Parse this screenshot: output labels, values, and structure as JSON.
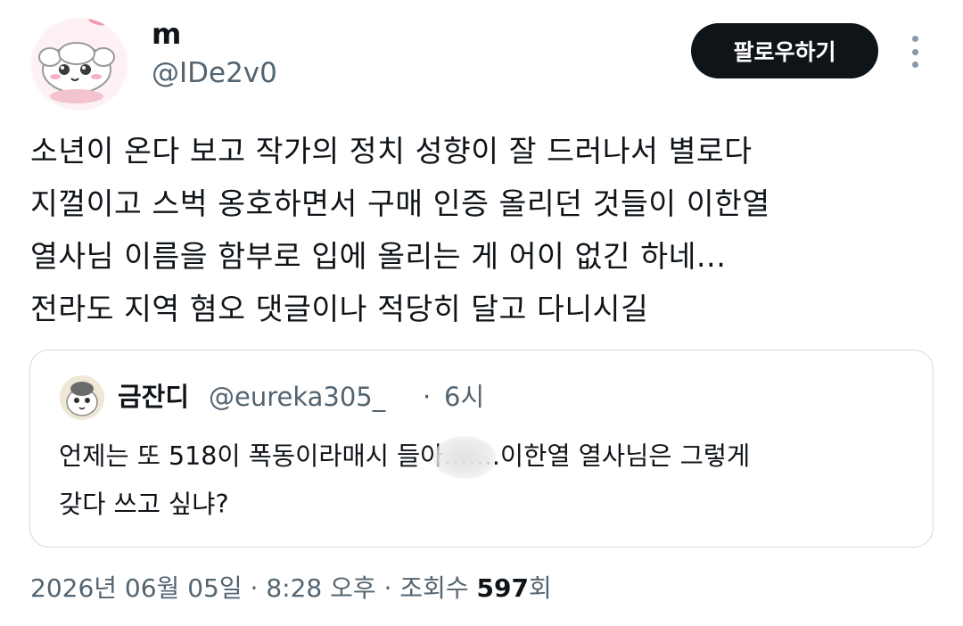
{
  "author": {
    "name": "m",
    "handle": "@IDe2v0"
  },
  "follow_button": {
    "label": "팔로우하기"
  },
  "more_menu": {
    "icon": "more-vertical-icon"
  },
  "tweet": {
    "lines": [
      "소년이 온다 보고 작가의 정치 성향이 잘 드러나서 별로다",
      "지껄이고 스벅 옹호하면서 구매 인증 올리던 것들이 이한열",
      "열사님 이름을 함부로 입에 올리는 게 어이 없긴 하네...",
      "전라도 지역 혐오 댓글이나 적당히 달고 다니시길"
    ]
  },
  "quoted_tweet": {
    "name": "금잔디",
    "handle": "@eureka305_",
    "separator": "·",
    "time": "6시",
    "lines": [
      "언제는 또 518이 폭동이라매시 들아.......이한열 열사님은 그렇게",
      "갖다 쓰고 싶냐?"
    ]
  },
  "meta": {
    "date": "2026년 06월 05일",
    "separator1": "·",
    "time": "8:28 오후",
    "separator2": "·",
    "views_label": "조회수",
    "views_count": "597",
    "views_suffix": "회"
  },
  "colors": {
    "text": "#0f1419",
    "secondary": "#536471",
    "button_bg": "#0f1419",
    "border": "#cfd9de"
  }
}
